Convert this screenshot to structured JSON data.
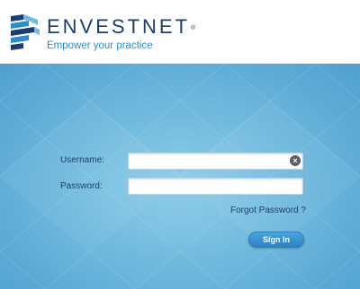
{
  "brand": {
    "name": "ENVESTNET",
    "trademark": "®",
    "tagline": "Empower your practice",
    "primary_color": "#1c3d72",
    "accent_color": "#2a8fc8"
  },
  "login_form": {
    "username_label": "Username:",
    "username_value": "",
    "password_label": "Password:",
    "password_value": "",
    "clear_icon": "×",
    "forgot_password_label": "Forgot Password ?",
    "sign_in_label": "Sign In"
  },
  "colors": {
    "background_light": "#8fcde8",
    "background_dark": "#4f9fcf",
    "button": "#2a82c4"
  }
}
